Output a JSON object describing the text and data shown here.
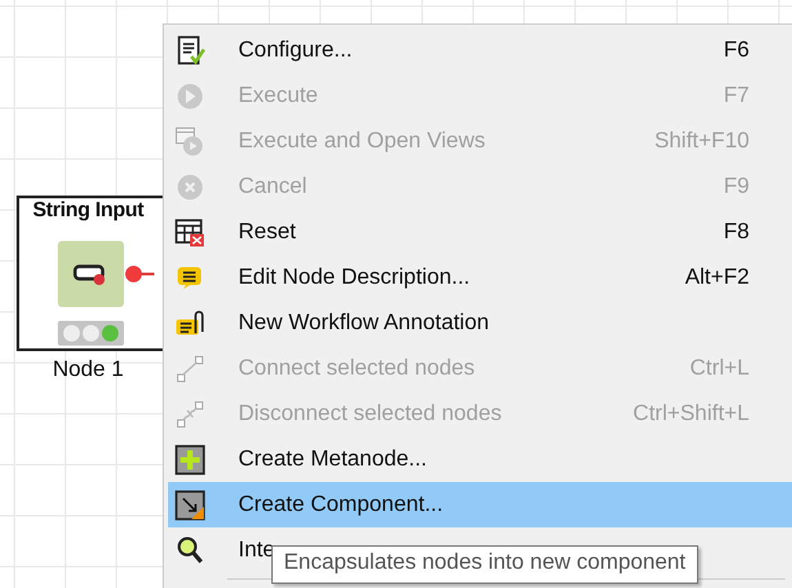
{
  "node": {
    "title": "String Input",
    "label": "Node 1",
    "lights": [
      {
        "color": "#eeeeee"
      },
      {
        "color": "#eeeeee"
      },
      {
        "color": "#5bbf3f"
      }
    ]
  },
  "context_menu": {
    "items": [
      {
        "kind": "configure",
        "label": "Configure...",
        "shortcut": "F6",
        "disabled": false,
        "selected": false
      },
      {
        "kind": "execute",
        "label": "Execute",
        "shortcut": "F7",
        "disabled": true,
        "selected": false
      },
      {
        "kind": "views",
        "label": "Execute and Open Views",
        "shortcut": "Shift+F10",
        "disabled": true,
        "selected": false
      },
      {
        "kind": "cancel",
        "label": "Cancel",
        "shortcut": "F9",
        "disabled": true,
        "selected": false
      },
      {
        "kind": "reset",
        "label": "Reset",
        "shortcut": "F8",
        "disabled": false,
        "selected": false
      },
      {
        "kind": "note",
        "label": "Edit Node Description...",
        "shortcut": "Alt+F2",
        "disabled": false,
        "selected": false
      },
      {
        "kind": "annotation",
        "label": "New Workflow Annotation",
        "disabled": false,
        "selected": false
      },
      {
        "kind": "connect",
        "label": "Connect selected nodes",
        "shortcut": "Ctrl+L",
        "disabled": true,
        "selected": false
      },
      {
        "kind": "disconnect",
        "label": "Disconnect selected nodes",
        "shortcut": "Ctrl+Shift+L",
        "disabled": true,
        "selected": false
      },
      {
        "kind": "metanode",
        "label": "Create Metanode...",
        "disabled": false,
        "selected": false
      },
      {
        "kind": "component",
        "label": "Create Component...",
        "disabled": false,
        "selected": true
      },
      {
        "kind": "view",
        "label": "Inte",
        "disabled": false,
        "selected": false
      }
    ]
  },
  "tooltip": {
    "text": "Encapsulates nodes into new component"
  }
}
